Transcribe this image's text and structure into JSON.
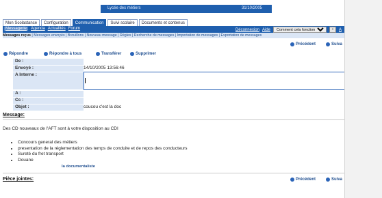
{
  "header": {
    "title": "Lycée des métiers",
    "date": "31/10/2005"
  },
  "tabs": [
    {
      "label": "Mon Scolastance",
      "active": false
    },
    {
      "label": "Configuration",
      "active": false
    },
    {
      "label": "Communication",
      "active": true
    },
    {
      "label": "Suivi scolaire",
      "active": false
    },
    {
      "label": "Documents et contenus",
      "active": false
    }
  ],
  "nav": {
    "links": [
      "Messagerie",
      "Agenda",
      "Actualités",
      "Forum"
    ],
    "right_links": [
      "Déconnexion",
      "Aide"
    ],
    "help_select": "Comment cela fonctionne ?",
    "go_label": "»",
    "cut_text": "A"
  },
  "subnav": {
    "current": "Messages reçus",
    "items": "| Messages envoyés | Brouillons | Nouveau message | Règles | Recherche de messages | Importation de messages | Exportation de messages"
  },
  "toolbar": {
    "prev": "Précédent",
    "next": "Suiva",
    "reply": "Répondre",
    "reply_all": "Répondre à tous",
    "forward": "Transférer",
    "delete": "Supprimer"
  },
  "fields": {
    "de_label": "De :",
    "de_value": "",
    "envoye_label": "Envoyé :",
    "envoye_value": "14/10/2005 13:56:46",
    "a_interne_label": "A Interne :",
    "a_label": "A :",
    "cc_label": "Cc :",
    "objet_label": "Objet :",
    "objet_value": "coucou c'est la doc"
  },
  "message": {
    "heading": "Message:",
    "intro": "Des CD nouveaux de l'AFT sont à votre disposition au CDI",
    "items": [
      "Concours general des métiers",
      "presentation de la réglementation des temps de conduite et de repos des conducteurs",
      "Sureté du fret transport",
      "Douane"
    ],
    "signature": "la documentaliste"
  },
  "attachments": {
    "heading": "Pièce jointes:"
  },
  "footer": {
    "prev": "Précédent",
    "next": "Suiva"
  }
}
